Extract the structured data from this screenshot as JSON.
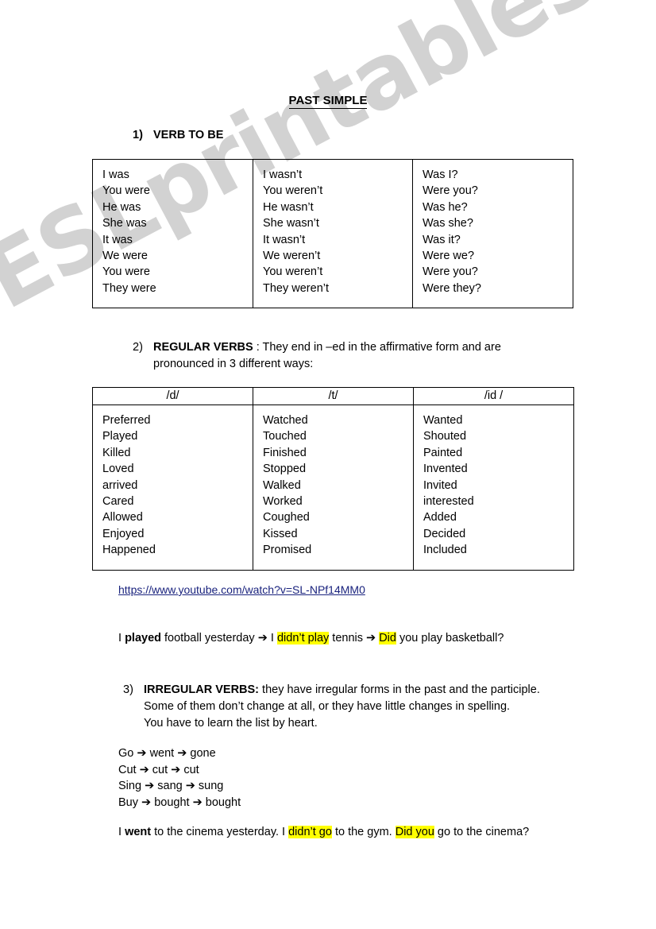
{
  "watermark": "ESLprintables.com",
  "title": "PAST SIMPLE",
  "sections": {
    "one": {
      "number": "1)",
      "label": "VERB TO BE"
    },
    "two": {
      "number": "2)",
      "label": "REGULAR VERBS",
      "text_after_label": " : They end in    –ed in the affirmative form    and are",
      "line2": "pronounced in 3 different ways:"
    },
    "three": {
      "number": "3)",
      "label": "IRREGULAR VERBS:",
      "text_after_label": " they have irregular forms in the past and the participle.",
      "line2": "Some of them don’t change at all, or they have little changes in spelling.",
      "line3": "You have to learn the list by heart."
    }
  },
  "table_to_be": {
    "affirmative": [
      "I was",
      "You were",
      "He was",
      "She was",
      "It was",
      "We were",
      "You were",
      "They were"
    ],
    "negative": [
      "I wasn’t",
      "You weren’t",
      "He wasn’t",
      "She wasn’t",
      "It wasn’t",
      "We weren’t",
      "You weren’t",
      "They weren’t"
    ],
    "interrogative": [
      "Was I?",
      "Were you?",
      "Was he?",
      "Was she?",
      "Was it?",
      "Were we?",
      "Were you?",
      "Were they?"
    ]
  },
  "table_regular": {
    "headers": [
      "/d/",
      "/t/",
      "/id /"
    ],
    "col_d": [
      "Preferred",
      "Played",
      "Killed",
      "Loved",
      "arrived",
      "Cared",
      "Allowed",
      "Enjoyed",
      "Happened"
    ],
    "col_t": [
      "Watched",
      "Touched",
      "Finished",
      "Stopped",
      "Walked",
      "Worked",
      "Coughed",
      "Kissed",
      "Promised"
    ],
    "col_id": [
      "Wanted",
      "Shouted",
      "Painted",
      "Invented",
      "Invited",
      "interested",
      "Added",
      "Decided",
      "Included"
    ]
  },
  "link": {
    "text": "https://www.youtube.com/watch?v=SL-NPf14MM0",
    "color": "#1a237e"
  },
  "example_regular": {
    "p1": "I ",
    "bold1": "played",
    "p2": " football yesterday ",
    "arrow1": "➔",
    "p3": " I ",
    "hl1": "didn’t play",
    "p4": " tennis ",
    "arrow2": "➔",
    "p5": " ",
    "hl2": "Did",
    "p6": " you play basketball?"
  },
  "irregular_verbs": [
    {
      "base": "Go",
      "past": "went",
      "participle": "gone"
    },
    {
      "base": "Cut",
      "past": "cut",
      "participle": "cut"
    },
    {
      "base": "Sing",
      "past": "sang",
      "participle": "sung"
    },
    {
      "base": "Buy",
      "past": "bought",
      "participle": "bought"
    }
  ],
  "arrow_glyph": "➔",
  "example_irregular": {
    "p1": "I ",
    "bold1": "went",
    "p2": " to the cinema yesterday. I ",
    "hl1": "didn’t go",
    "p3": " to the gym. ",
    "hl2": "Did you",
    "p4": " go to the cinema?"
  },
  "colors": {
    "highlight": "#ffff00",
    "watermark": "#d2d2d2",
    "link": "#1a237e"
  }
}
